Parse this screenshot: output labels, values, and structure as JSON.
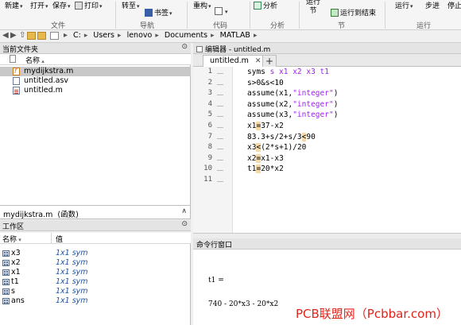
{
  "toolstrip": {
    "buttons": {
      "new": "新建",
      "open": "打开",
      "save": "保存",
      "print": "打印",
      "goto": "转至",
      "bookmark": "书签",
      "refactor": "重构",
      "analyze": "分析",
      "run_section": "运行\n节",
      "run_to_end": "运行到结束",
      "run": "运行",
      "step": "步进",
      "stop": "停止"
    },
    "groups": {
      "file": "文件",
      "navigate": "导航",
      "code": "代码",
      "analyze": "分析",
      "section": "节",
      "run": "运行"
    }
  },
  "address": {
    "path": [
      "C:",
      "Users",
      "lenovo",
      "Documents",
      "MATLAB"
    ]
  },
  "file_browser": {
    "title": "当前文件夹",
    "column_name": "名称",
    "files": [
      {
        "name": "mydijkstra.m",
        "selected": true,
        "icon": "function-file-icon"
      },
      {
        "name": "untitled.asv",
        "selected": false,
        "icon": "file-icon"
      },
      {
        "name": "untitled.m",
        "selected": false,
        "icon": "script-file-icon"
      }
    ]
  },
  "details": {
    "text": "mydijkstra.m  (函数)"
  },
  "workspace": {
    "title": "工作区",
    "col_name": "名称",
    "col_value": "值",
    "vars": [
      {
        "name": "x3",
        "value": "1x1 sym"
      },
      {
        "name": "x2",
        "value": "1x1 sym"
      },
      {
        "name": "x1",
        "value": "1x1 sym"
      },
      {
        "name": "t1",
        "value": "1x1 sym"
      },
      {
        "name": "s",
        "value": "1x1 sym"
      },
      {
        "name": "ans",
        "value": "1x1 sym"
      }
    ]
  },
  "editor": {
    "title": "编辑器 - untitled.m",
    "tab": "untitled.m",
    "lines": [
      {
        "n": "1",
        "parts": [
          {
            "t": "syms ",
            "c": ""
          },
          {
            "t": "s x1 x2 x3 t1",
            "c": "kw"
          }
        ]
      },
      {
        "n": "2",
        "parts": [
          {
            "t": "s>0&s<10",
            "c": ""
          }
        ]
      },
      {
        "n": "3",
        "parts": [
          {
            "t": "assume(x1,",
            "c": ""
          },
          {
            "t": "\"integer\"",
            "c": "str"
          },
          {
            "t": ")",
            "c": ""
          }
        ]
      },
      {
        "n": "4",
        "parts": [
          {
            "t": "assume(x2,",
            "c": ""
          },
          {
            "t": "\"integer\"",
            "c": "str"
          },
          {
            "t": ")",
            "c": ""
          }
        ]
      },
      {
        "n": "5",
        "parts": [
          {
            "t": "assume(x3,",
            "c": ""
          },
          {
            "t": "\"integer\"",
            "c": "str"
          },
          {
            "t": ")",
            "c": ""
          }
        ]
      },
      {
        "n": "6",
        "parts": [
          {
            "t": "x1",
            "c": ""
          },
          {
            "t": "=",
            "c": "hl"
          },
          {
            "t": "37-x2",
            "c": ""
          }
        ]
      },
      {
        "n": "7",
        "parts": [
          {
            "t": "83.3+s/2+s/3",
            "c": ""
          },
          {
            "t": "<",
            "c": "hl"
          },
          {
            "t": "90",
            "c": ""
          }
        ]
      },
      {
        "n": "8",
        "parts": [
          {
            "t": "x3",
            "c": ""
          },
          {
            "t": "<",
            "c": "hl"
          },
          {
            "t": "(2*s+1)/20",
            "c": ""
          }
        ]
      },
      {
        "n": "9",
        "parts": [
          {
            "t": "x2",
            "c": ""
          },
          {
            "t": "=",
            "c": "hl"
          },
          {
            "t": "x1-x3",
            "c": ""
          }
        ]
      },
      {
        "n": "10",
        "parts": [
          {
            "t": "t1",
            "c": ""
          },
          {
            "t": "=",
            "c": "hl"
          },
          {
            "t": "20*x2",
            "c": ""
          }
        ]
      },
      {
        "n": "11",
        "parts": []
      }
    ]
  },
  "command_window": {
    "title": "命令行窗口",
    "lines": [
      "t1 =",
      "740 - 20*x3 - 20*x2"
    ]
  },
  "watermark": "PCB联盟网（Pcbbar.com）"
}
